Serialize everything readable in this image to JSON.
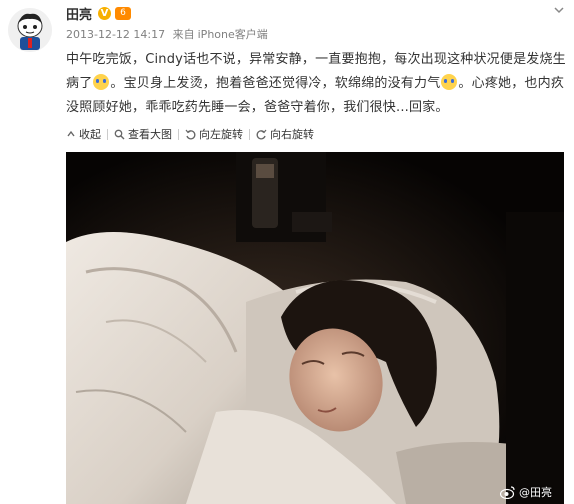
{
  "post": {
    "author": "田亮",
    "level_badge": "6",
    "timestamp": "2013-12-12 14:17",
    "source_prefix": "来自",
    "source": "iPhone客户端",
    "text_parts": [
      "中午吃完饭，Cindy话也不说，异常安静，一直要抱抱，每次出现这种状况便是发烧生病了",
      "。宝贝身上发烫，抱着爸爸还觉得冷，软绵绵的没有力气",
      "。心疼她，也内疚没照顾好她，乖乖吃药先睡一会，爸爸守着你，我们很快...回家。"
    ],
    "emojis": [
      "crying-emoji",
      "crying-emoji"
    ]
  },
  "toolbar": {
    "collapse": "收起",
    "view_large": "查看大图",
    "rotate_left": "向左旋转",
    "rotate_right": "向右旋转"
  },
  "photo": {
    "watermark": "@田亮"
  },
  "icons": [
    "avatar",
    "verified-v-icon",
    "level-badge-icon",
    "chevron-down-icon",
    "collapse-icon",
    "magnifier-icon",
    "rotate-left-icon",
    "rotate-right-icon",
    "weibo-logo-icon"
  ],
  "colors": {
    "source_link": "#eb7350",
    "verified": "#f7b000",
    "text": "#333333",
    "meta": "#808080"
  }
}
